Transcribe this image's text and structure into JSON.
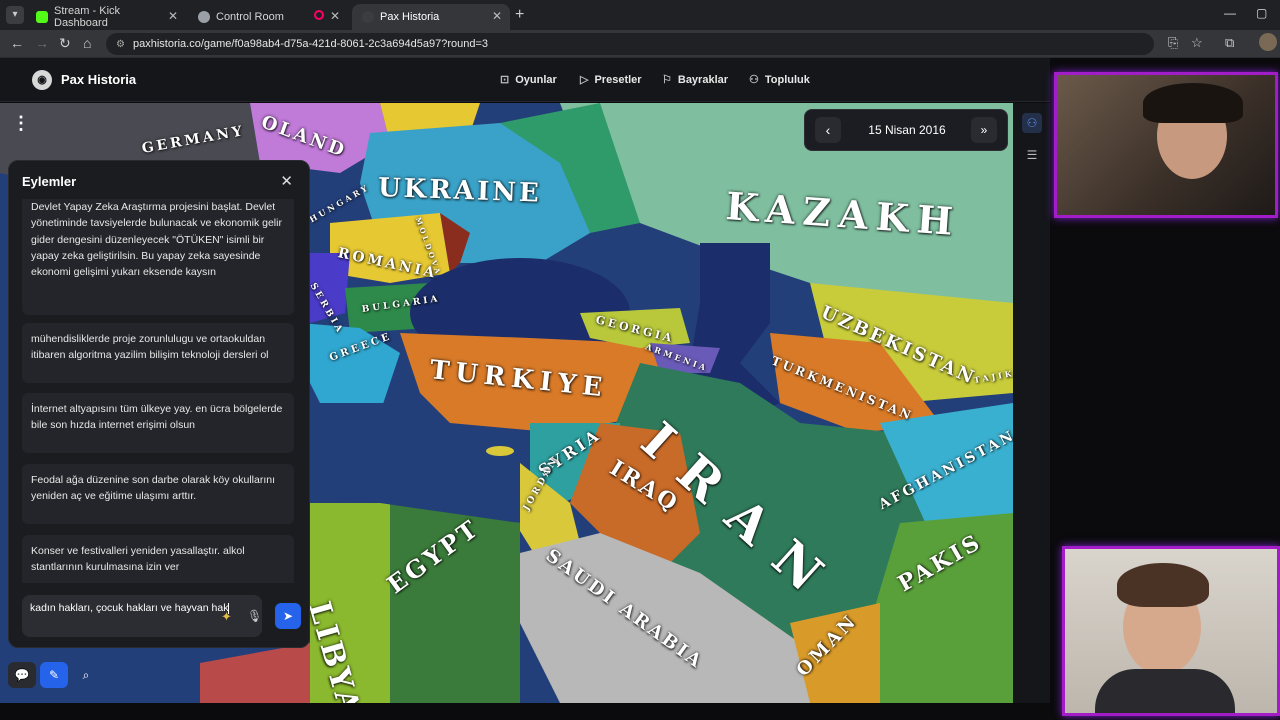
{
  "browser": {
    "tabs": [
      {
        "title": "Stream - Kick Dashboard",
        "favicon_color": "#53fc18"
      },
      {
        "title": "Control Room",
        "favicon_color": "#9aa0a6"
      },
      {
        "title": "Pax Historia",
        "favicon_color": "#3c3d41"
      }
    ],
    "url": "paxhistoria.co/game/f0a98ab4-d75a-421d-8061-2c3a694d5a97?round=3"
  },
  "header": {
    "brand": "Pax Historia",
    "nav": [
      {
        "label": "Oyunlar",
        "icon": "gamepad-icon"
      },
      {
        "label": "Presetler",
        "icon": "play-icon"
      },
      {
        "label": "Bayraklar",
        "icon": "flag-icon"
      },
      {
        "label": "Topluluk",
        "icon": "users-icon"
      }
    ]
  },
  "date_control": {
    "date": "15 Nisan 2016"
  },
  "map": {
    "labels": [
      "OLAND",
      "GERMANY",
      "UKRAINE",
      "KAZAKH",
      "ROMANIA",
      "BULGARIA",
      "SERBIA",
      "GREECE",
      "GEORGIA",
      "ARMENIA",
      "TURKIYE",
      "IRAN",
      "UZBEKISTAN",
      "TURKMENISTAN",
      "SYRIA",
      "IRAQ",
      "AFGHANISTAN",
      "PAKIS",
      "JORDAN",
      "EGYPT",
      "SAUDI ARABIA",
      "OMAN",
      "LIBYA",
      "TAJIK",
      "HUNGARY",
      "MOLDOVA"
    ]
  },
  "panel": {
    "title": "Eylemler",
    "actions": [
      "Devlet Yapay Zeka Araştırma projesini başlat. Devlet yönetiminde tavsiyelerde bulunacak ve ekonomik gelir gider dengesini düzenleyecek \"ÖTÜKEN\" isimli bir yapay zeka geliştirilsin. Bu yapay zeka sayesinde ekonomi gelişimi yukarı eksende kaysın",
      "mühendisliklerde proje zorunlulugu ve ortaokuldan itibaren algoritma yazilim bilişim teknoloji dersleri ol",
      "İnternet altyapısını tüm ülkeye yay. en ücra bölgelerde bile son hızda internet erişimi olsun",
      "Feodal ağa düzenine son darbe olarak köy okullarını yeniden aç ve eğitime ulaşımı arttır.",
      "Konser ve festivalleri yeniden yasallaştır. alkol stantlarının kurulmasına izin ver"
    ],
    "input_value": "kadın hakları, çocuk hakları ve hayvan hak"
  },
  "colors": {
    "accent": "#2563eb",
    "cam_border": "#a21cc7",
    "sea": "#233f7a"
  }
}
